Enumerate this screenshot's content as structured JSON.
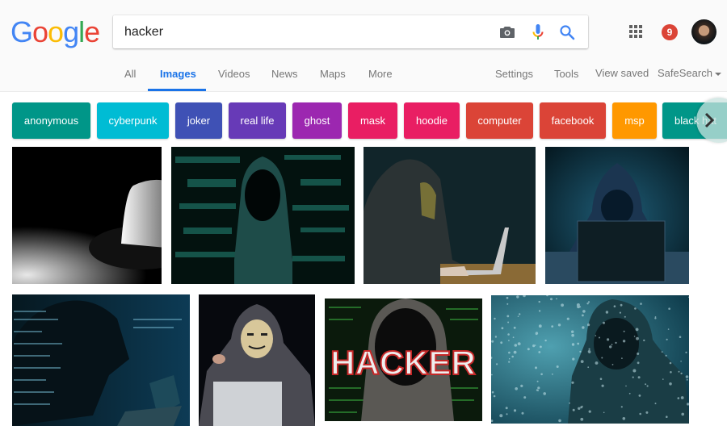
{
  "logo": {
    "letters": [
      "G",
      "o",
      "o",
      "g",
      "l",
      "e"
    ],
    "colors": [
      "#4285f4",
      "#ea4335",
      "#fbbc05",
      "#4285f4",
      "#34a853",
      "#ea4335"
    ]
  },
  "search": {
    "query": "hacker",
    "placeholder": ""
  },
  "icons": {
    "camera": "camera-icon",
    "mic": "microphone-icon",
    "search": "search-icon",
    "apps": "apps-grid-icon"
  },
  "notifications": {
    "count": "9"
  },
  "nav": {
    "tabs": [
      {
        "label": "All",
        "active": false
      },
      {
        "label": "Images",
        "active": true
      },
      {
        "label": "Videos",
        "active": false
      },
      {
        "label": "News",
        "active": false
      },
      {
        "label": "Maps",
        "active": false
      },
      {
        "label": "More",
        "active": false
      }
    ],
    "settings": "Settings",
    "tools": "Tools",
    "view_saved": "View saved",
    "safesearch": "SafeSearch"
  },
  "chips": [
    {
      "label": "anonymous",
      "color": "#009688"
    },
    {
      "label": "cyberpunk",
      "color": "#00bcd4"
    },
    {
      "label": "joker",
      "color": "#3f51b5"
    },
    {
      "label": "real life",
      "color": "#673ab7"
    },
    {
      "label": "ghost",
      "color": "#9c27b0"
    },
    {
      "label": "mask",
      "color": "#e91e63"
    },
    {
      "label": "hoodie",
      "color": "#e91e63"
    },
    {
      "label": "computer",
      "color": "#db4437"
    },
    {
      "label": "facebook",
      "color": "#db4437"
    },
    {
      "label": "msp",
      "color": "#ff9800"
    },
    {
      "label": "black hat",
      "color": "#009688"
    }
  ],
  "results": [
    {
      "description": "white fedora hat in spotlight"
    },
    {
      "description": "hooded figure with green code background"
    },
    {
      "description": "masked hooded hacker typing on laptop"
    },
    {
      "description": "hooded hacker lit by laptop screen"
    },
    {
      "description": "hooded hacker with code overlay and laptop"
    },
    {
      "description": "guy fawkes mask hacker pointing"
    },
    {
      "description": "HACKER text over hooded figure",
      "overlay_text": "HACKER"
    },
    {
      "description": "hooded figure with digital number rain"
    }
  ]
}
